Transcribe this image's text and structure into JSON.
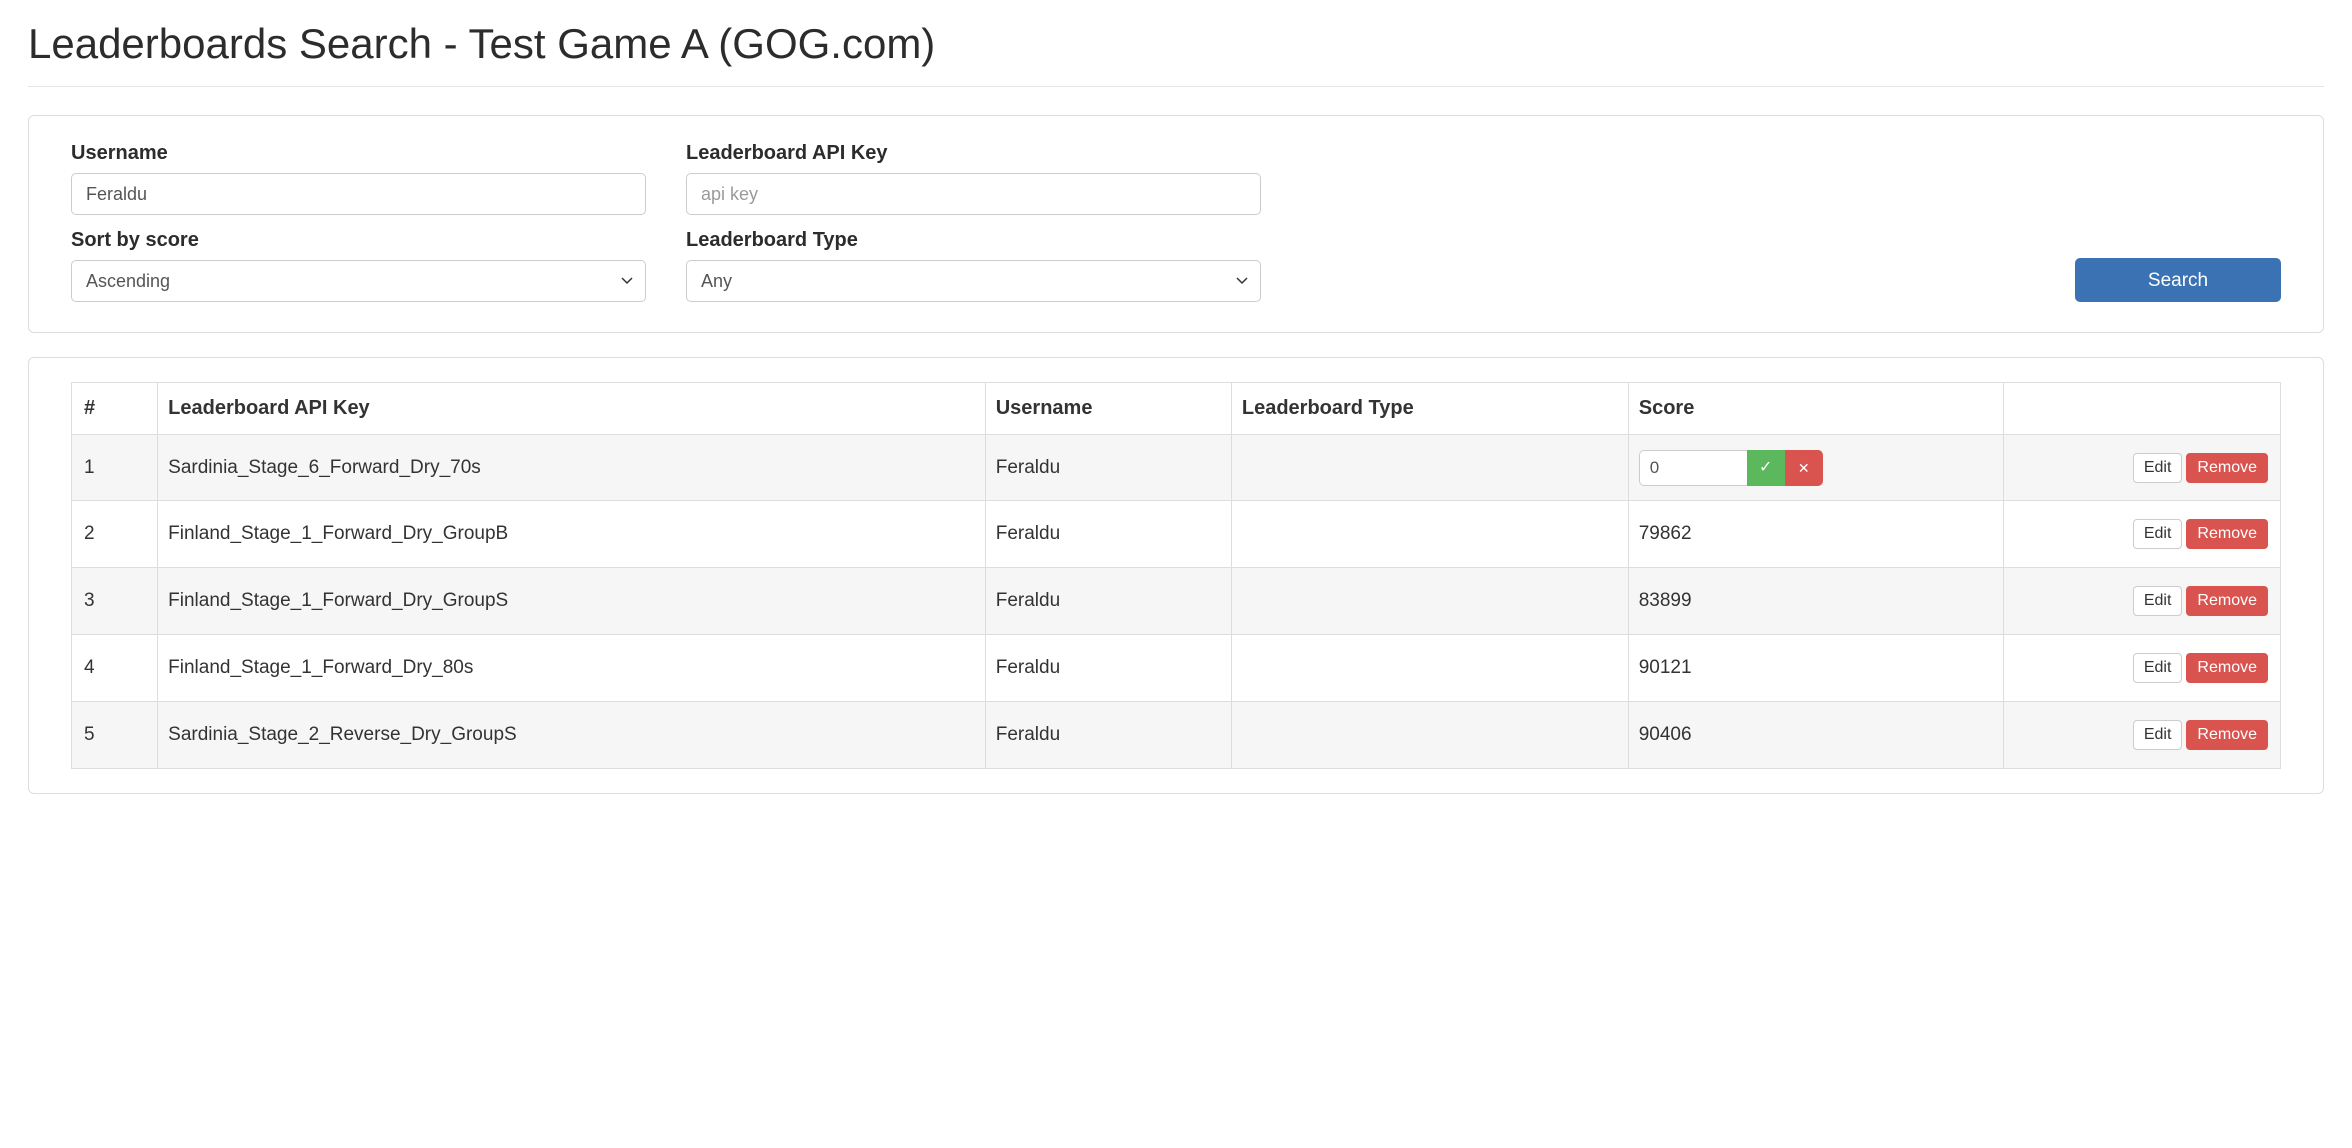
{
  "page_title": "Leaderboards Search - Test Game A (GOG.com)",
  "form": {
    "username_label": "Username",
    "username_value": "Feraldu",
    "apikey_label": "Leaderboard API Key",
    "apikey_placeholder": "api key",
    "sort_label": "Sort by score",
    "sort_value": "Ascending",
    "type_label": "Leaderboard Type",
    "type_value": "Any",
    "search_button": "Search"
  },
  "table": {
    "headers": {
      "index": "#",
      "apikey": "Leaderboard API Key",
      "username": "Username",
      "type": "Leaderboard Type",
      "score": "Score"
    },
    "actions": {
      "edit": "Edit",
      "remove": "Remove"
    },
    "rows": [
      {
        "idx": "1",
        "apikey": "Sardinia_Stage_6_Forward_Dry_70s",
        "username": "Feraldu",
        "type": "",
        "score": "0",
        "editing": true
      },
      {
        "idx": "2",
        "apikey": "Finland_Stage_1_Forward_Dry_GroupB",
        "username": "Feraldu",
        "type": "",
        "score": "79862",
        "editing": false
      },
      {
        "idx": "3",
        "apikey": "Finland_Stage_1_Forward_Dry_GroupS",
        "username": "Feraldu",
        "type": "",
        "score": "83899",
        "editing": false
      },
      {
        "idx": "4",
        "apikey": "Finland_Stage_1_Forward_Dry_80s",
        "username": "Feraldu",
        "type": "",
        "score": "90121",
        "editing": false
      },
      {
        "idx": "5",
        "apikey": "Sardinia_Stage_2_Reverse_Dry_GroupS",
        "username": "Feraldu",
        "type": "",
        "score": "90406",
        "editing": false
      }
    ]
  }
}
